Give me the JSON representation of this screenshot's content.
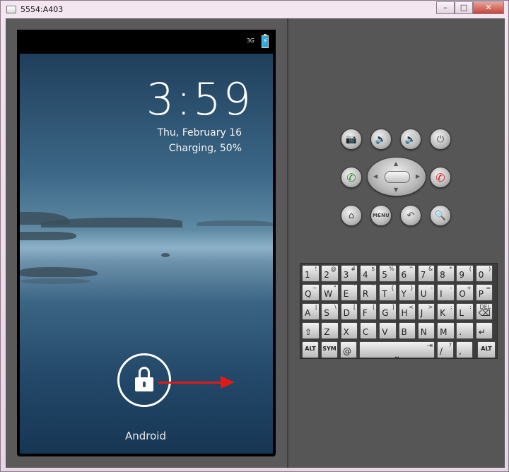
{
  "window": {
    "title": "5554:A403",
    "min_glyph": "–",
    "max_glyph": "□",
    "close_glyph": "✕"
  },
  "status_bar": {
    "network": "3G",
    "battery_glyph": "⚡"
  },
  "lockscreen": {
    "time": "3:59",
    "date": "Thu, February 16",
    "charging": "Charging, 50%",
    "carrier": "Android"
  },
  "hw_buttons": {
    "camera": "📷",
    "vol_down": "🔉",
    "vol_up": "🔊",
    "power": "⏻",
    "call": "✆",
    "end": "✆",
    "home": "⌂",
    "menu": "MENU",
    "back": "↶",
    "search": "🔍",
    "dpad_up": "▲",
    "dpad_down": "▼",
    "dpad_left": "◀",
    "dpad_right": "▶"
  },
  "keyboard": {
    "row1": [
      {
        "m": "1",
        "s": "!"
      },
      {
        "m": "2",
        "s": "@"
      },
      {
        "m": "3",
        "s": "#"
      },
      {
        "m": "4",
        "s": "$"
      },
      {
        "m": "5",
        "s": "%"
      },
      {
        "m": "6",
        "s": "^"
      },
      {
        "m": "7",
        "s": "&"
      },
      {
        "m": "8",
        "s": "*"
      },
      {
        "m": "9",
        "s": "("
      },
      {
        "m": "0",
        "s": ")"
      }
    ],
    "row2": [
      {
        "m": "Q",
        "s": "~"
      },
      {
        "m": "W",
        "s": "\""
      },
      {
        "m": "E",
        "s": "´"
      },
      {
        "m": "R",
        "s": "`"
      },
      {
        "m": "T",
        "s": "{"
      },
      {
        "m": "Y",
        "s": "}"
      },
      {
        "m": "U",
        "s": "-"
      },
      {
        "m": "I",
        "s": "-"
      },
      {
        "m": "O",
        "s": "+"
      },
      {
        "m": "P",
        "s": "="
      }
    ],
    "row3": [
      {
        "m": "A",
        "s": "|"
      },
      {
        "m": "S",
        "s": "\\"
      },
      {
        "m": "D",
        "s": "["
      },
      {
        "m": "F",
        "s": "["
      },
      {
        "m": "G",
        "s": "]"
      },
      {
        "m": "H",
        "s": "<"
      },
      {
        "m": "J",
        "s": ">"
      },
      {
        "m": "K",
        "s": ";"
      },
      {
        "m": "L",
        "s": ":"
      },
      {
        "m": "⌫",
        "s": "DEL"
      }
    ],
    "row4": [
      {
        "m": "⇧",
        "s": ""
      },
      {
        "m": "Z",
        "s": ""
      },
      {
        "m": "X",
        "s": ""
      },
      {
        "m": "C",
        "s": ""
      },
      {
        "m": "V",
        "s": ""
      },
      {
        "m": "B",
        "s": ""
      },
      {
        "m": "N",
        "s": ""
      },
      {
        "m": "M",
        "s": ""
      },
      {
        "m": ".",
        "s": ""
      },
      {
        "m": "↵",
        "s": ""
      }
    ],
    "row5": {
      "alt_left": "ALT",
      "sym": "SYM",
      "at": "@",
      "space": "⎵",
      "tab": "⇥",
      "slash": "/",
      "slash_alt": "?",
      "comma": ",",
      "alt_right": "ALT"
    }
  }
}
